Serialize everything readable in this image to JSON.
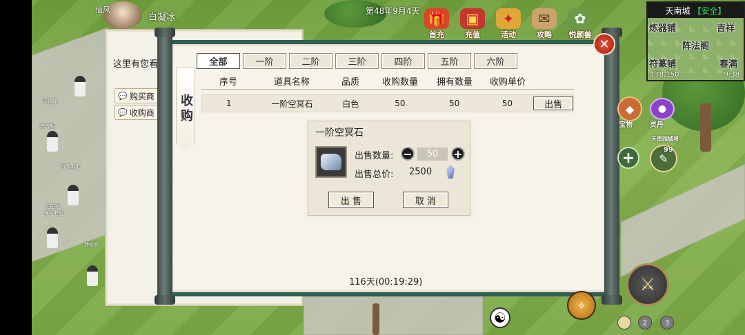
{
  "hud": {
    "player_name": "白凝冰",
    "top_left_badge": "仙风",
    "date": "第48年9月4天",
    "top_icons": [
      {
        "label": "首充",
        "icon": "gift-box-icon",
        "color": "#d9452b"
      },
      {
        "label": "充值",
        "icon": "treasure-chest-icon",
        "color": "#c4372a"
      },
      {
        "label": "活动",
        "icon": "ribbon-icon",
        "color": "#e0a637"
      },
      {
        "label": "攻略",
        "icon": "scroll-icon",
        "color": "#caa46a"
      },
      {
        "label": "悦颜兽",
        "icon": "beast-icon",
        "color": "#6b9a48"
      }
    ]
  },
  "minimap": {
    "city": "天南城",
    "status": "【安全】",
    "labels": [
      "炼器铺",
      "吉祥",
      "阵法阁",
      "符篆铺",
      "春满"
    ],
    "coords": "178,150",
    "time": "9:38"
  },
  "npc_dialog": {
    "text": "这里有您看",
    "options": [
      "购买商",
      "收购商"
    ]
  },
  "panel": {
    "side_title": "收购",
    "close_icon": "close-icon",
    "tabs": [
      "全部",
      "一阶",
      "二阶",
      "三阶",
      "四阶",
      "五阶",
      "六阶"
    ],
    "active_tab": 0,
    "columns": [
      "序号",
      "道具名称",
      "品质",
      "收购数量",
      "拥有数量",
      "收购单价"
    ],
    "rows": [
      {
        "index": "1",
        "name": "一阶空冥石",
        "quality": "白色",
        "buy_qty": "50",
        "owned_qty": "50",
        "price": "50",
        "action": "出售"
      }
    ],
    "timer": "116天(00:19:29)"
  },
  "sell_dialog": {
    "title": "一阶空冥石",
    "qty_label": "出售数量:",
    "qty_value": "50",
    "total_label": "出售总价:",
    "total_value": "2500",
    "sell_label": "出 售",
    "cancel_label": "取 消"
  },
  "right_hud": {
    "fragment_label": "宝物",
    "spirit_label": "灵丹",
    "nameplate": "天南园城将",
    "level": "99",
    "pages": [
      "2",
      "3"
    ]
  },
  "world_labels": {
    "npc1": "天道峰",
    "npc2": "炼气期",
    "npc3": "符篆事柜",
    "npc4": "阳阳雅",
    "npc5": "练气七层",
    "npc6": "静修阁"
  }
}
